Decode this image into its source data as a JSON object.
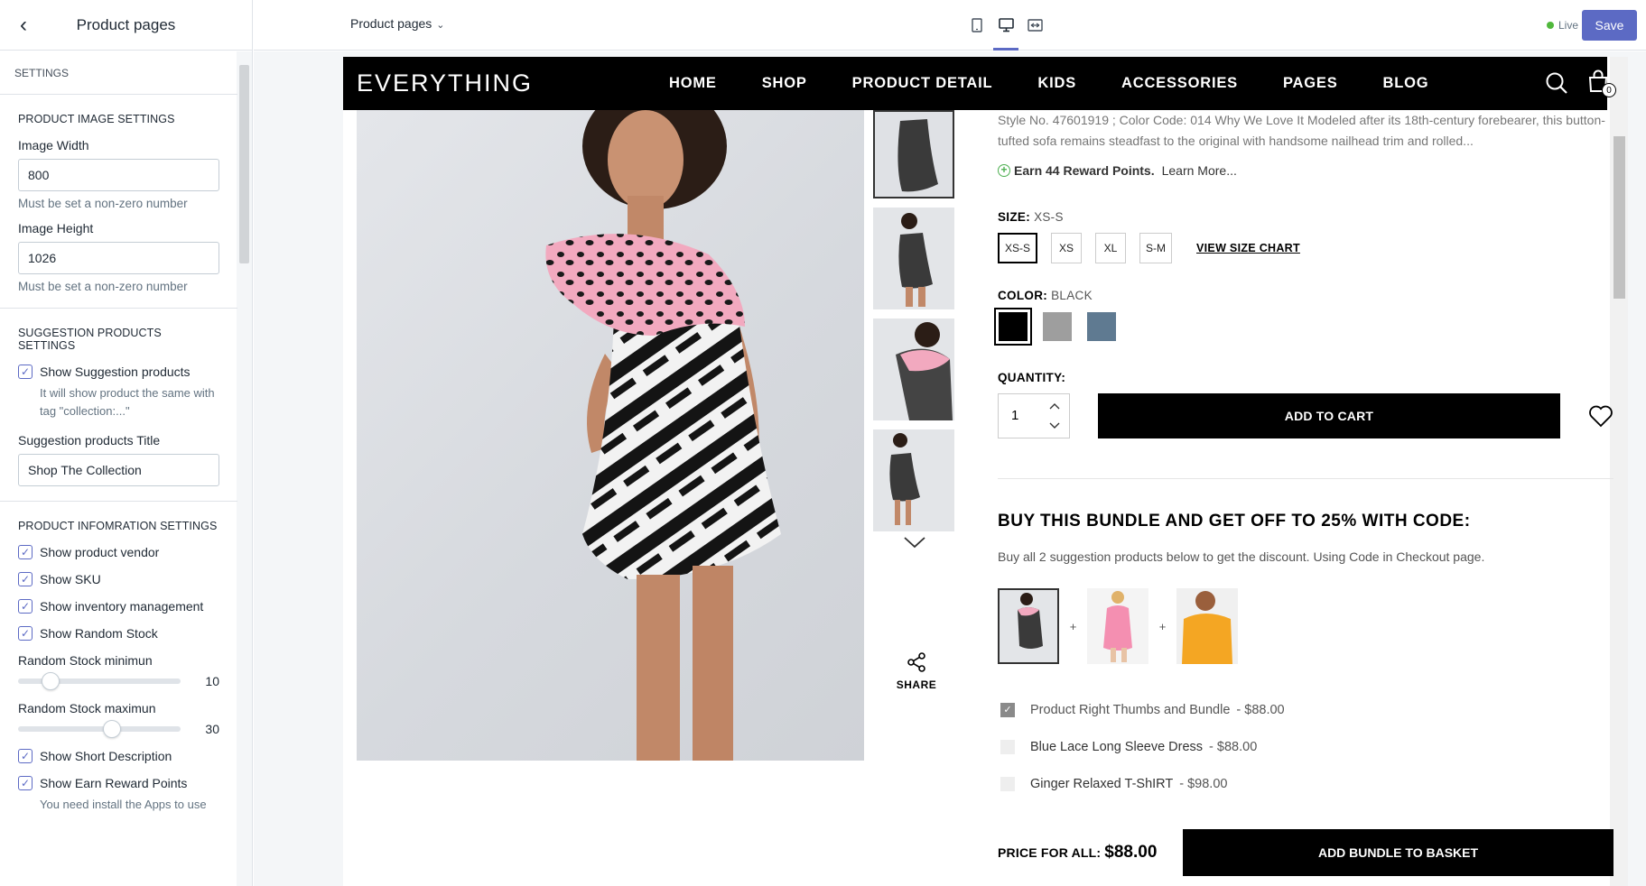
{
  "sidebar": {
    "title": "Product pages",
    "section_head": "SETTINGS",
    "image_settings": {
      "heading": "PRODUCT IMAGE SETTINGS",
      "width_label": "Image Width",
      "width_value": "800",
      "width_help": "Must be set a non-zero number",
      "height_label": "Image Height",
      "height_value": "1026",
      "height_help": "Must be set a non-zero number"
    },
    "suggestion_settings": {
      "heading": "SUGGESTION PRODUCTS SETTINGS",
      "show_label": "Show Suggestion products",
      "show_help": "It will show product the same with tag \"collection:...\"",
      "title_label": "Suggestion products Title",
      "title_value": "Shop The Collection"
    },
    "info_settings": {
      "heading": "PRODUCT INFOMRATION SETTINGS",
      "show_vendor": "Show product vendor",
      "show_sku": "Show SKU",
      "show_inventory": "Show inventory management",
      "show_random_stock": "Show Random Stock",
      "stock_min_label": "Random Stock minimun",
      "stock_min_value": "10",
      "stock_min_level": 0.2,
      "stock_max_label": "Random Stock maximun",
      "stock_max_value": "30",
      "stock_max_level": 0.58,
      "show_short_desc": "Show Short Description",
      "show_reward": "Show Earn Reward Points",
      "reward_help": "You need install the Apps to use"
    }
  },
  "topbar": {
    "page_select": "Product pages",
    "live_label": "Live",
    "save_label": "Save",
    "accent": "#5c6ac4"
  },
  "store": {
    "logo": "EVERYTHING",
    "menu": [
      "HOME",
      "SHOP",
      "PRODUCT DETAIL",
      "KIDS",
      "ACCESSORIES",
      "PAGES",
      "BLOG"
    ],
    "cart_count": "0"
  },
  "product": {
    "description": "Style No. 47601919 ; Color Code: 014 Why We Love It Modeled after its 18th-century forebearer, this button-tufted sofa remains steadfast to the original with handsome nailhead trim and rolled...",
    "reward_text": "Earn 44 Reward Points.",
    "reward_link": "Learn More...",
    "size_label": "SIZE:",
    "size_selected": "XS-S",
    "sizes": [
      "XS-S",
      "XS",
      "XL",
      "S-M"
    ],
    "size_chart": "VIEW SIZE CHART",
    "color_label": "COLOR:",
    "color_selected": "BLACK",
    "colors": [
      "#000000",
      "#9e9e9e",
      "#5f7a91"
    ],
    "qty_label": "QUANTITY:",
    "qty_value": "1",
    "add_to_cart": "ADD TO CART",
    "share_label": "SHARE"
  },
  "bundle": {
    "title": "BUY THIS BUNDLE AND GET OFF TO 25% WITH CODE:",
    "subtitle": "Buy all 2 suggestion products below to get the discount. Using Code in Checkout page.",
    "items": [
      {
        "name": "Product Right Thumbs and Bundle",
        "price": "- $88.00"
      },
      {
        "name": "Blue Lace Long Sleeve Dress",
        "price": "- $88.00"
      },
      {
        "name": "Ginger Relaxed T-ShIRT",
        "price": "- $98.00"
      }
    ],
    "price_label": "PRICE FOR ALL:",
    "price_value": "$88.00",
    "add_bundle": "ADD BUNDLE TO BASKET"
  }
}
